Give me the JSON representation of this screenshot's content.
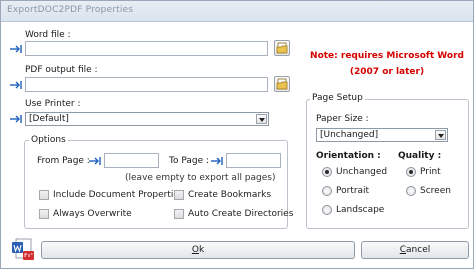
{
  "window": {
    "title": "ExportDOC2PDF Properties"
  },
  "word_file": {
    "label": "Word file :",
    "value": ""
  },
  "pdf_output": {
    "label": "PDF output file :",
    "value": ""
  },
  "printer": {
    "label": "Use Printer :",
    "selected": "[Default]"
  },
  "note": {
    "line1": "Note: requires Microsoft Word",
    "line2": "(2007 or later)"
  },
  "options": {
    "title": "Options",
    "from_page_label": "From Page :",
    "from_page_value": "",
    "to_page_label": "To Page :",
    "to_page_value": "",
    "hint": "(leave empty to export all pages)",
    "include_doc_props": "Include Document Properties",
    "create_bookmarks": "Create Bookmarks",
    "always_overwrite": "Always Overwrite",
    "auto_create_dirs": "Auto Create Directories"
  },
  "page_setup": {
    "title": "Page Setup",
    "paper_size_label": "Paper Size :",
    "paper_size_selected": "[Unchanged]",
    "orientation_label": "Orientation :",
    "orientation_options": [
      "Unchanged",
      "Portrait",
      "Landscape"
    ],
    "orientation_selected": "Unchanged",
    "quality_label": "Quality :",
    "quality_options": [
      "Print",
      "Screen"
    ],
    "quality_selected": "Print"
  },
  "buttons": {
    "ok_prefix": "",
    "ok_underlined": "O",
    "ok_rest": "k",
    "cancel_prefix": "",
    "cancel_underlined": "C",
    "cancel_rest": "ancel"
  },
  "colors": {
    "note": "#d40000",
    "accent_arrow": "#1f5fbf"
  }
}
